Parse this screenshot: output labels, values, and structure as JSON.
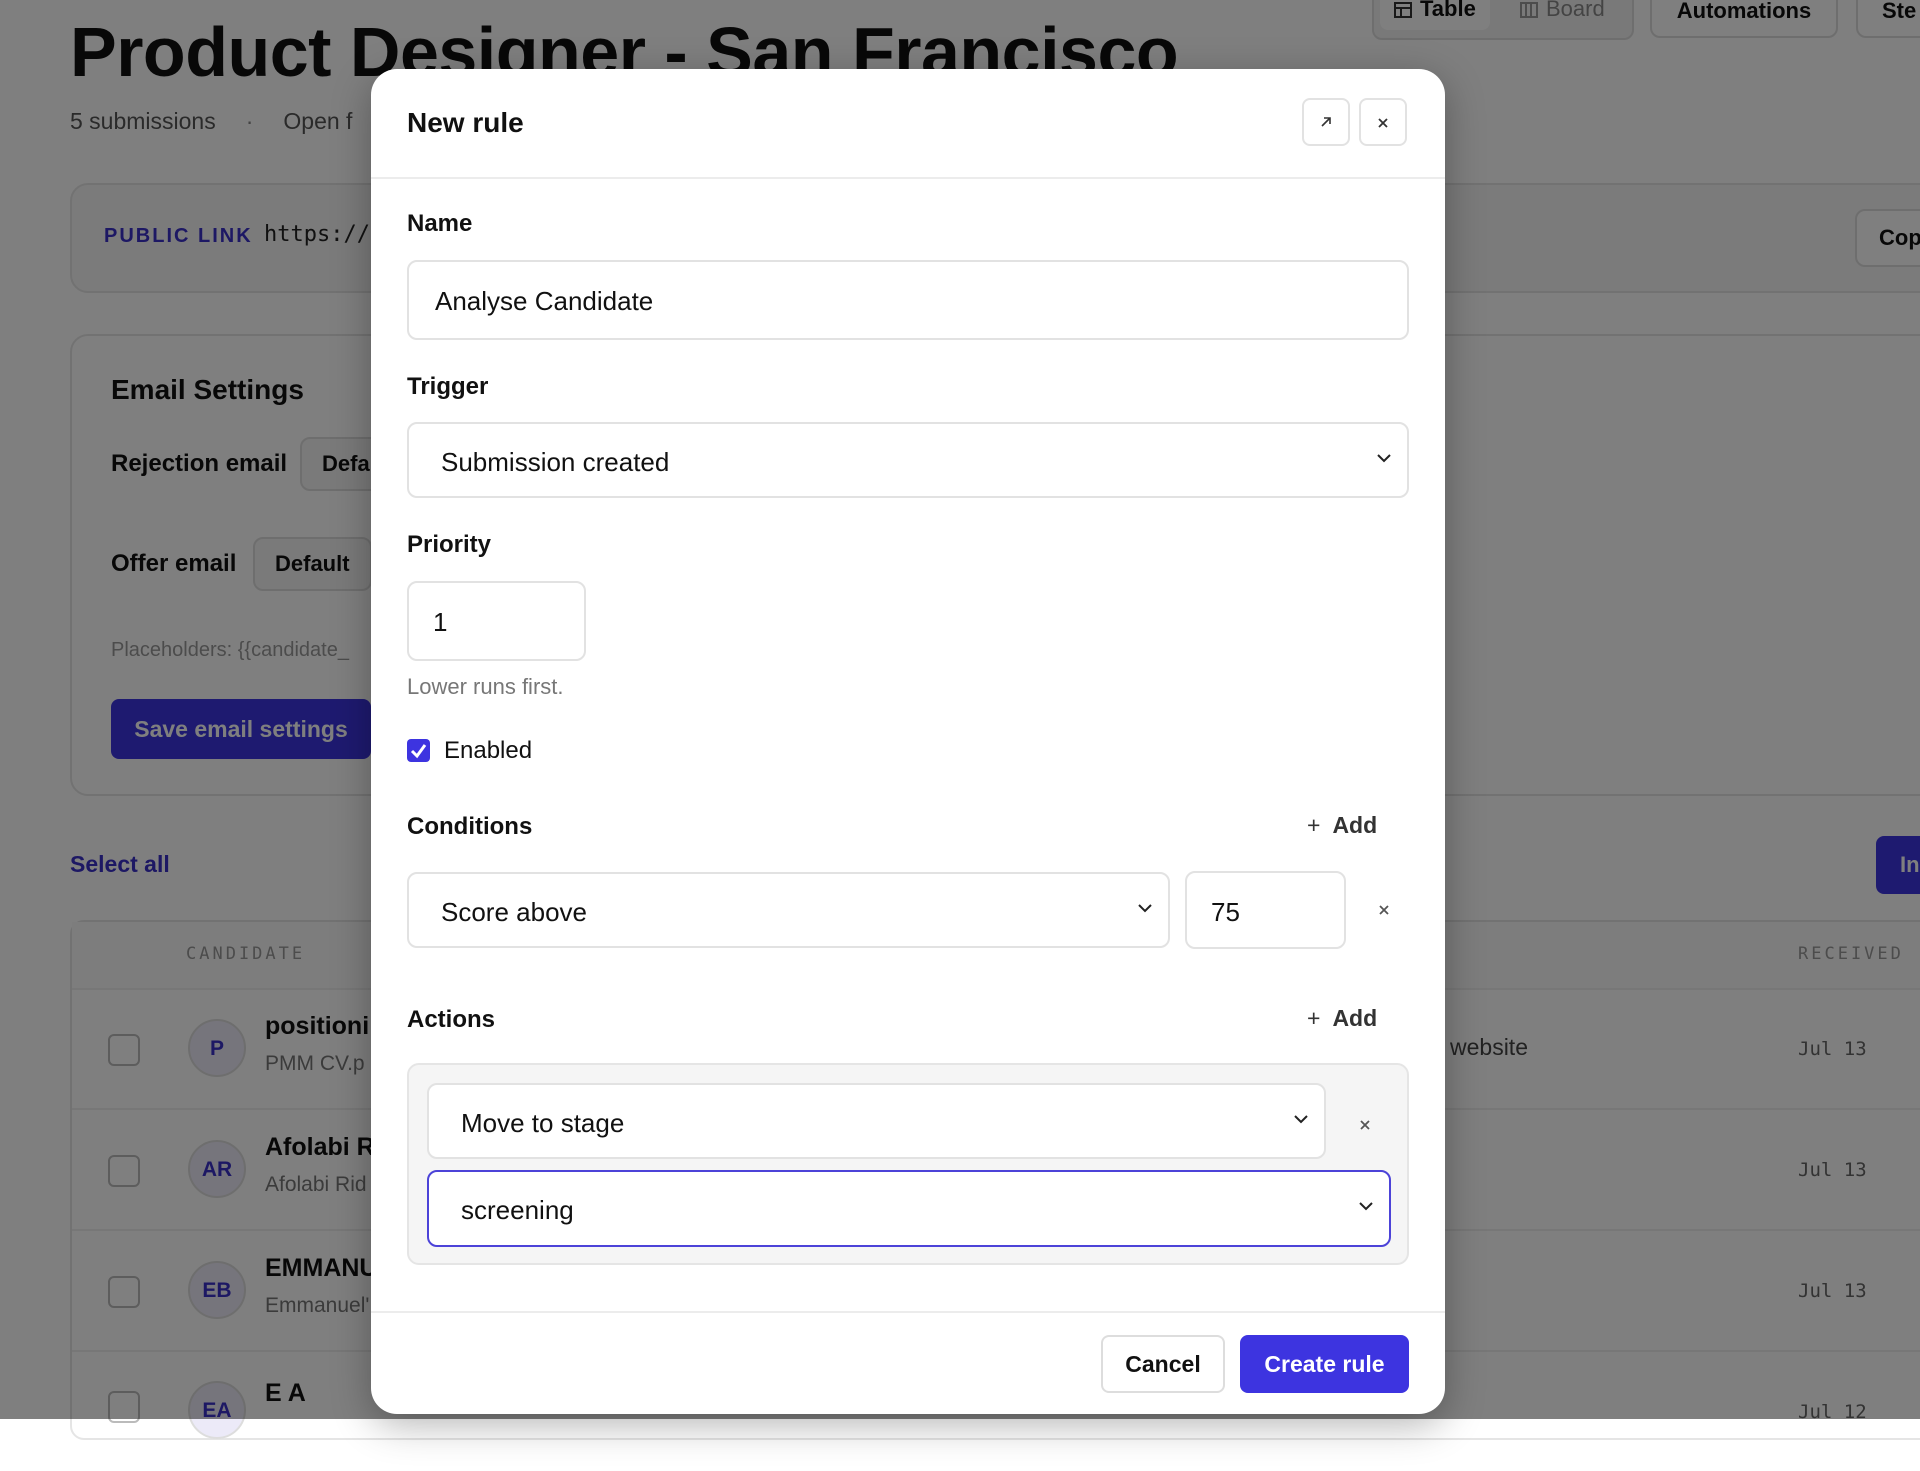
{
  "page": {
    "title": "Product Designer - San Francisco",
    "submissions": "5 submissions",
    "status": "Open f",
    "view_tabs": [
      "Table",
      "Board"
    ],
    "automations_label": "Automations",
    "steps_label": "Ste",
    "public_link_label": "PUBLIC LINK",
    "public_link_url": "https://",
    "copy_label": "Cop",
    "email_settings": {
      "title": "Email Settings",
      "rejection_label": "Rejection email",
      "rejection_value": "Defa",
      "offer_label": "Offer email",
      "offer_value": "Default",
      "placeholders": "Placeholders: {{candidate_",
      "save_label": "Save email settings"
    },
    "select_all": "Select all",
    "right_button": "In",
    "table": {
      "headers": [
        "CANDIDATE",
        "RECEIVED"
      ],
      "rows": [
        {
          "initials": "P",
          "name": "positioni",
          "sub": "PMM CV.p",
          "extra": "website",
          "received": "Jul 13"
        },
        {
          "initials": "AR",
          "name": "Afolabi R",
          "sub": "Afolabi Rid",
          "extra": "",
          "received": "Jul 13"
        },
        {
          "initials": "EB",
          "name": "EMMANU",
          "sub": "Emmanuel'",
          "extra": "",
          "received": "Jul 13"
        },
        {
          "initials": "EA",
          "name": "E A",
          "sub": "",
          "extra": "",
          "received": "Jul 12"
        }
      ]
    }
  },
  "modal": {
    "title": "New rule",
    "icons": [
      "expand-icon",
      "close-icon"
    ],
    "name_label": "Name",
    "name_value": "Analyse Candidate",
    "trigger_label": "Trigger",
    "trigger_value": "Submission created",
    "priority_label": "Priority",
    "priority_value": "1",
    "priority_hint": "Lower runs first.",
    "enabled_label": "Enabled",
    "enabled": true,
    "conditions_label": "Conditions",
    "add_label": "Add",
    "condition": {
      "type": "Score above",
      "value": "75"
    },
    "actions_label": "Actions",
    "action": {
      "type": "Move to stage",
      "stage": "screening"
    },
    "cancel_label": "Cancel",
    "create_label": "Create rule"
  },
  "colors": {
    "accent": "#3d34e0",
    "overlay": "rgba(0,0,0,0.5)"
  }
}
